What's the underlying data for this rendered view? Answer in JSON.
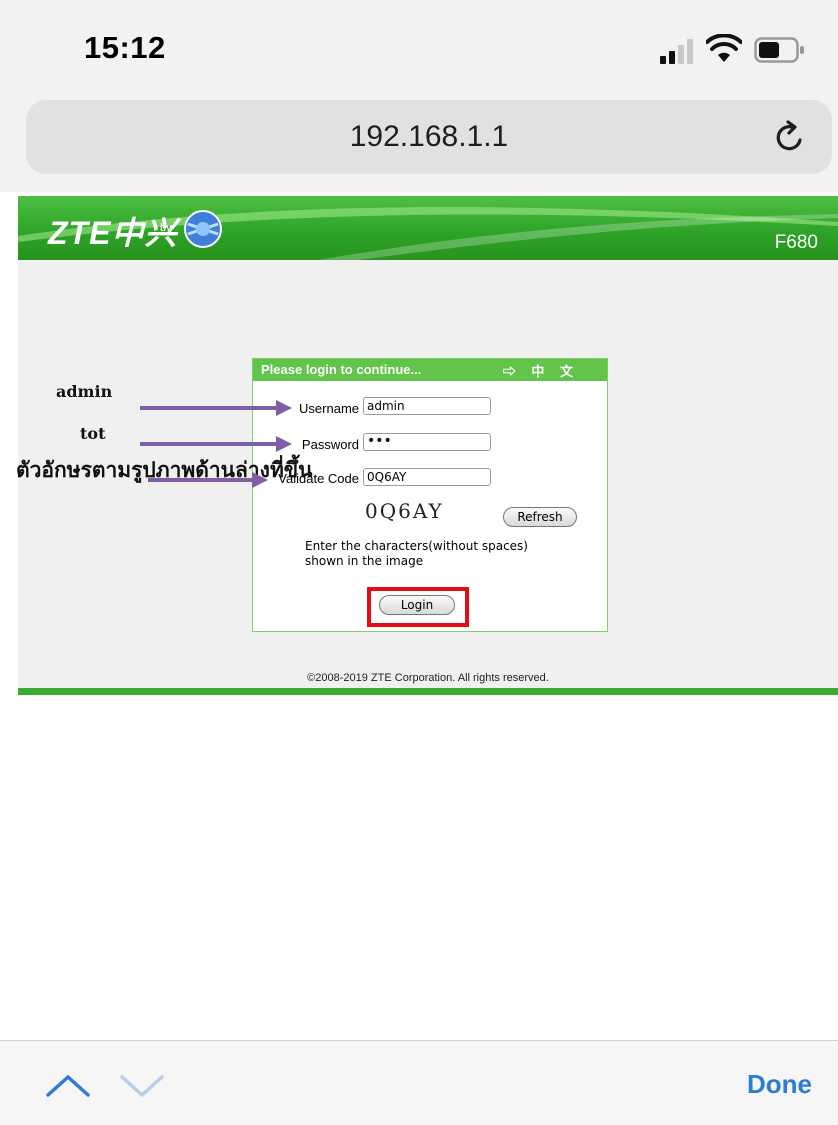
{
  "status_bar": {
    "time": "15:12",
    "icons": [
      "signal-icon",
      "wifi-icon",
      "battery-icon"
    ]
  },
  "browser": {
    "url": "192.168.1.1",
    "reload_icon": "reload-icon"
  },
  "router": {
    "logo": "ZTE中兴",
    "logo_by": "by",
    "model": "F680",
    "colors": {
      "banner": "#2ea428",
      "login_header": "#62c44a",
      "highlight": "#e30c17",
      "done": "#2e7bd6"
    }
  },
  "login": {
    "title": "Please login to continue...",
    "lang_link": "⇨ 中 文",
    "username_label": "Username",
    "username_value": "admin",
    "password_label": "Password",
    "password_value": "•••",
    "validate_label": "Validate Code",
    "validate_value": "0Q6AY",
    "captcha_text": "0Q6AY",
    "refresh_button": "Refresh",
    "hint_line1": "Enter the characters(without spaces)",
    "hint_line2": "shown in the image",
    "login_button": "Login"
  },
  "copyright": "©2008-2019 ZTE Corporation. All rights reserved.",
  "annotations": {
    "username_hint": "admin",
    "password_hint": "tot",
    "code_hint": "ตัวอักษรตามรูปภาพด้านล่างที่ขึ้น"
  },
  "toolbar": {
    "done_label": "Done"
  }
}
